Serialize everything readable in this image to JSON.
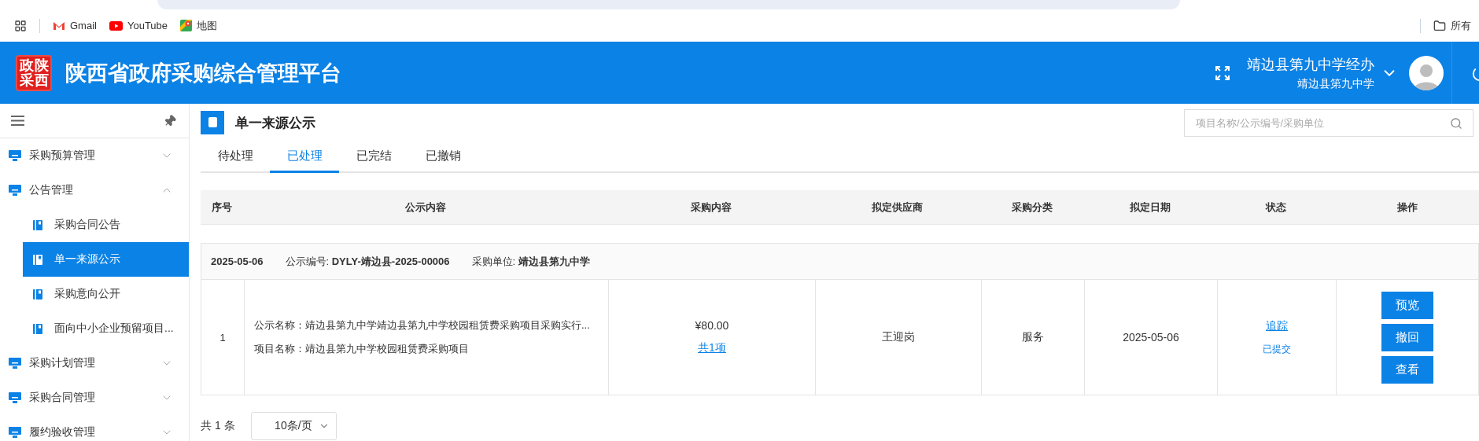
{
  "bookmarks": [
    {
      "label": "Gmail"
    },
    {
      "label": "YouTube"
    },
    {
      "label": "地图"
    }
  ],
  "bookmarks_right": "所有",
  "header": {
    "logo_chars": [
      "政",
      "陕",
      "采",
      "西"
    ],
    "title": "陕西省政府采购综合管理平台",
    "user_name": "靖边县第九中学经办",
    "user_org": "靖边县第九中学"
  },
  "sidebar": {
    "items": [
      {
        "label": "采购预算管理",
        "expanded": false
      },
      {
        "label": "公告管理",
        "expanded": true,
        "children": [
          {
            "label": "采购合同公告",
            "selected": false
          },
          {
            "label": "单一来源公示",
            "selected": true
          },
          {
            "label": "采购意向公开",
            "selected": false
          },
          {
            "label": "面向中小企业预留项目...",
            "selected": false
          }
        ]
      },
      {
        "label": "采购计划管理",
        "expanded": false
      },
      {
        "label": "采购合同管理",
        "expanded": false
      },
      {
        "label": "履约验收管理",
        "expanded": false
      }
    ]
  },
  "page": {
    "title": "单一来源公示",
    "search": {
      "placeholder": "项目名称/公示编号/采购单位"
    },
    "tabs": [
      {
        "label": "待处理",
        "selected": false
      },
      {
        "label": "已处理",
        "selected": true
      },
      {
        "label": "已完结",
        "selected": false
      },
      {
        "label": "已撤销",
        "selected": false
      }
    ],
    "table": {
      "columns": [
        "序号",
        "公示内容",
        "采购内容",
        "拟定供应商",
        "采购分类",
        "拟定日期",
        "状态",
        "操作"
      ],
      "groups": [
        {
          "date": "2025-05-06",
          "notice_no": "公示编号: **DYLY-靖边县-2025-00006**",
          "unit": "采购单位: **靖边县第九中学**",
          "rows": [
            {
              "index": "1",
              "notice_name": "公示名称：靖边县第九中学靖边县第九中学校园租赁费采购项目采购实行...",
              "project_name": "项目名称：靖边县第九中学校园租赁费采购项目",
              "amount": "¥80.00",
              "items_link": "共1项",
              "supplier": "王迎岗",
              "category": "服务",
              "date": "2025-05-06",
              "track_link": "追踪",
              "status": "已提交",
              "actions": [
                "预览",
                "撤回",
                "查看"
              ]
            }
          ]
        }
      ]
    },
    "pagination": {
      "total": "共 1 条",
      "page_size": "10条/页"
    }
  }
}
